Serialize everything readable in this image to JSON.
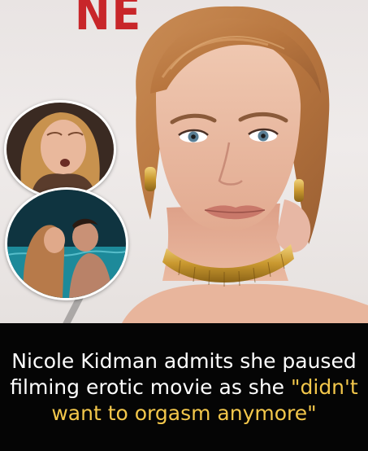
{
  "photo": {
    "backdrop_logo": "NE",
    "description_icon": "woman-portrait-photo"
  },
  "insets": [
    {
      "icon": "inset-photo-face"
    },
    {
      "icon": "inset-photo-pool-kiss"
    }
  ],
  "caption": {
    "lead": "Nicole Kidman admits she paused filming erotic movie as she ",
    "quote": "\"didn't want to orgasm anymore\""
  },
  "colors": {
    "caption_bg": "#050505",
    "caption_text": "#ffffff",
    "quote_highlight": "#f3c74b",
    "logo_red": "#c8262a"
  }
}
